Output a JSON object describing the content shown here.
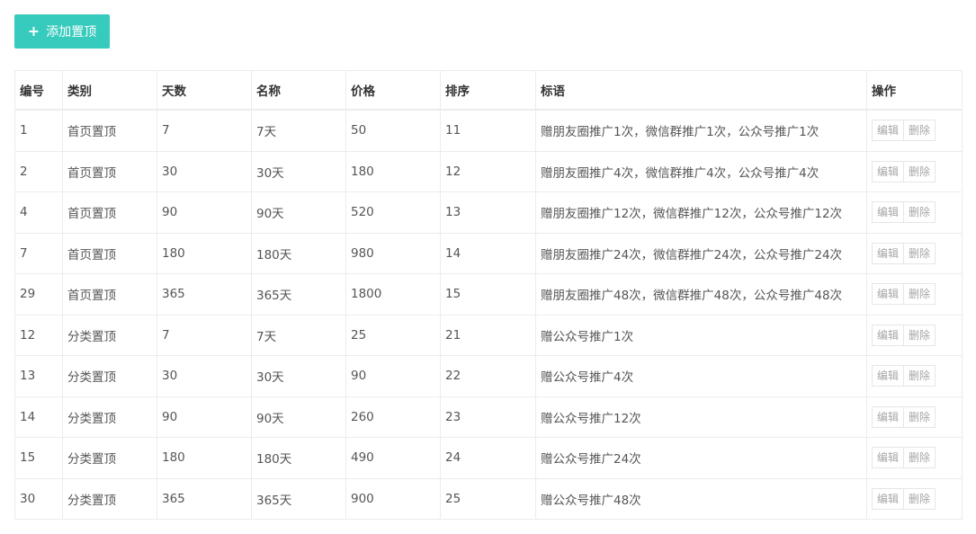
{
  "toolbar": {
    "add_icon": "+",
    "add_label": "添加置顶"
  },
  "table": {
    "columns": [
      "编号",
      "类别",
      "天数",
      "名称",
      "价格",
      "排序",
      "标语",
      "操作"
    ],
    "rows": [
      [
        "1",
        "首页置顶",
        "7",
        "7天",
        "50",
        "11",
        "赠朋友圈推广1次，微信群推广1次，公众号推广1次"
      ],
      [
        "2",
        "首页置顶",
        "30",
        "30天",
        "180",
        "12",
        "赠朋友圈推广4次，微信群推广4次，公众号推广4次"
      ],
      [
        "4",
        "首页置顶",
        "90",
        "90天",
        "520",
        "13",
        "赠朋友圈推广12次，微信群推广12次，公众号推广12次"
      ],
      [
        "7",
        "首页置顶",
        "180",
        "180天",
        "980",
        "14",
        "赠朋友圈推广24次，微信群推广24次，公众号推广24次"
      ],
      [
        "29",
        "首页置顶",
        "365",
        "365天",
        "1800",
        "15",
        "赠朋友圈推广48次，微信群推广48次，公众号推广48次"
      ],
      [
        "12",
        "分类置顶",
        "7",
        "7天",
        "25",
        "21",
        "赠公众号推广1次"
      ],
      [
        "13",
        "分类置顶",
        "30",
        "30天",
        "90",
        "22",
        "赠公众号推广4次"
      ],
      [
        "14",
        "分类置顶",
        "90",
        "90天",
        "260",
        "23",
        "赠公众号推广12次"
      ],
      [
        "15",
        "分类置顶",
        "180",
        "180天",
        "490",
        "24",
        "赠公众号推广24次"
      ],
      [
        "30",
        "分类置顶",
        "365",
        "365天",
        "900",
        "25",
        "赠公众号推广48次"
      ]
    ],
    "edit_label": "编辑",
    "delete_label": "删除"
  },
  "colors": {
    "accent": "#36cbbd",
    "border": "#ececec"
  }
}
